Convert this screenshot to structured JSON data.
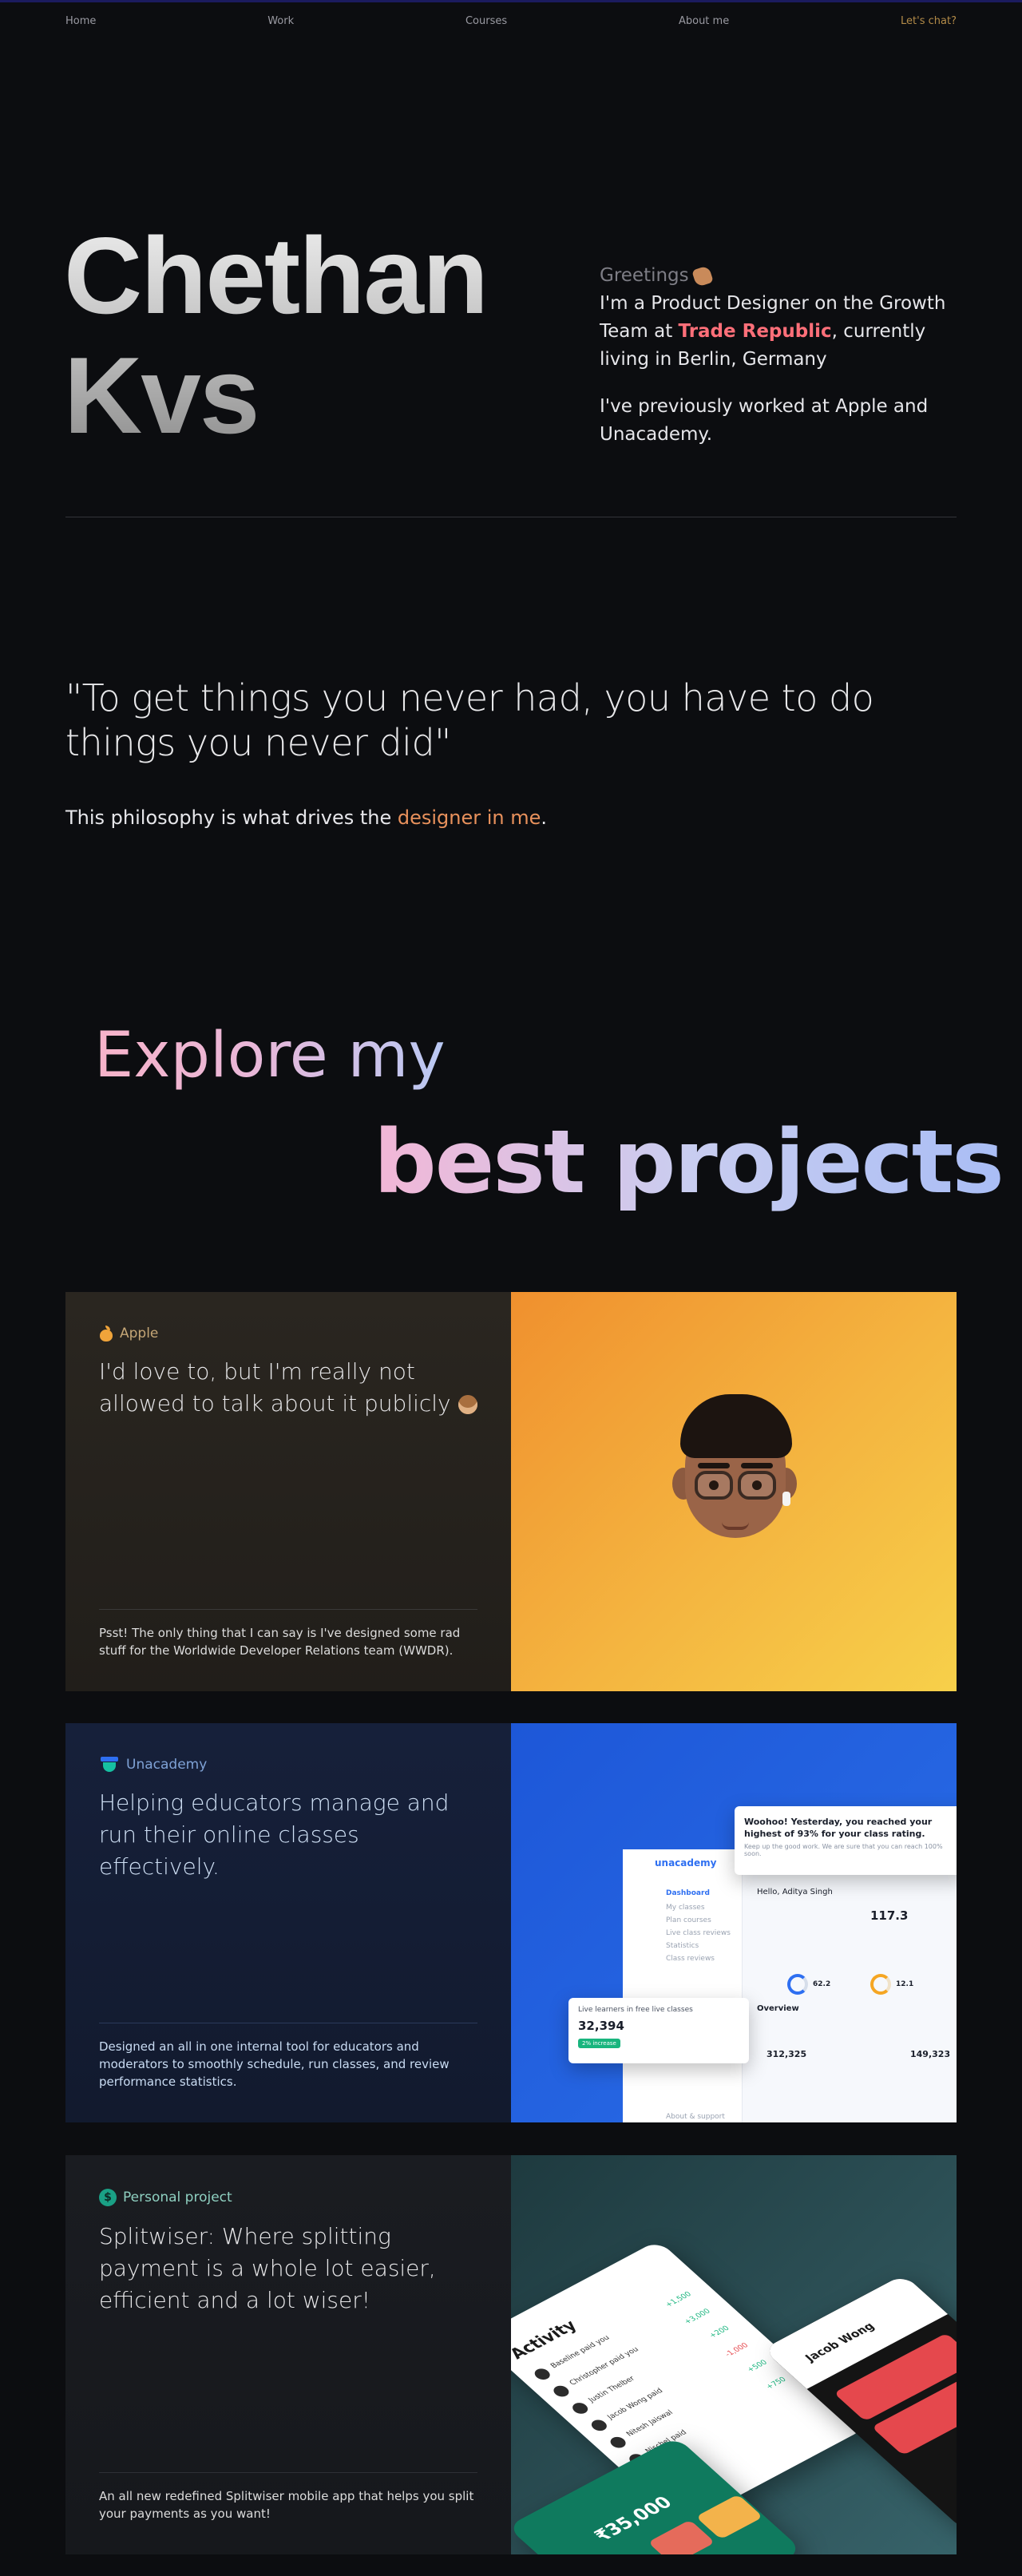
{
  "nav": {
    "home": "Home",
    "work": "Work",
    "courses": "Courses",
    "about": "About me",
    "chat": "Let's chat?"
  },
  "hero": {
    "name_line1": "Chethan",
    "name_line2": "Kvs",
    "greeting": "Greetings",
    "bio_pre": "I'm a Product Designer on the Growth Team at ",
    "company": "Trade Republic",
    "bio_post": ", currently living in Berlin, Germany",
    "bio2": "I've previously worked at Apple and Unacademy."
  },
  "quote": {
    "text": "\"To get things you never had, you have to do things you never did\"",
    "philo_pre": "This philosophy is what drives the ",
    "philo_hl": "designer in me",
    "philo_post": "."
  },
  "projects_heading": {
    "line1": "Explore my",
    "line2": "best projects"
  },
  "projects": [
    {
      "tag": "Apple",
      "headline": "I'd love to, but I'm really not allowed to talk about it publicly",
      "foot": "Psst! The only thing that I can say is I've designed some rad stuff for the Worldwide Developer Relations team (WWDR)."
    },
    {
      "tag": "Unacademy",
      "headline": "Helping educators manage and run their online classes effectively.",
      "foot": "Designed an all in one internal tool for educators and moderators to smoothly schedule, run classes, and review performance statistics.",
      "mock": {
        "logo": "unacademy",
        "menu": [
          "Dashboard",
          "My classes",
          "Plan courses",
          "Live class reviews",
          "Statistics",
          "Class reviews"
        ],
        "menu_bottom": "About & support",
        "hello": "Hello, Aditya Singh",
        "stat_big": "117.3",
        "bubble_title": "Woohoo! Yesterday, you reached your highest of 93% for your class rating.",
        "bubble_sub": "Keep up the good work. We are sure that you can reach 100% soon.",
        "live_title": "Live learners in free live classes",
        "live_value": "32,394",
        "live_badge": "2% increase",
        "ring1": "62.2",
        "ring2": "12.1",
        "overview": "Overview",
        "num1": "312,325",
        "num2": "149,323"
      }
    },
    {
      "tag": "Personal project",
      "headline": "Splitwiser: Where splitting payment is a whole lot easier, efficient and a lot wiser!",
      "foot": "An all new redefined Splitwiser mobile app that helps you split your payments as you want!",
      "mock": {
        "activity": "Activity",
        "rows": [
          {
            "t": "Baseline paid you",
            "a": "+1,500"
          },
          {
            "t": "Christopher paid you",
            "a": "+3,000"
          },
          {
            "t": "Justin Thelber",
            "a": "+200"
          },
          {
            "t": "Jacob Wong paid",
            "a": "-1,000"
          },
          {
            "t": "Nitesh Jaiswal",
            "a": "+500"
          },
          {
            "t": "Nischel paid",
            "a": "+750"
          }
        ],
        "balance": "₹35,000",
        "person": "Jacob Wong"
      }
    }
  ]
}
